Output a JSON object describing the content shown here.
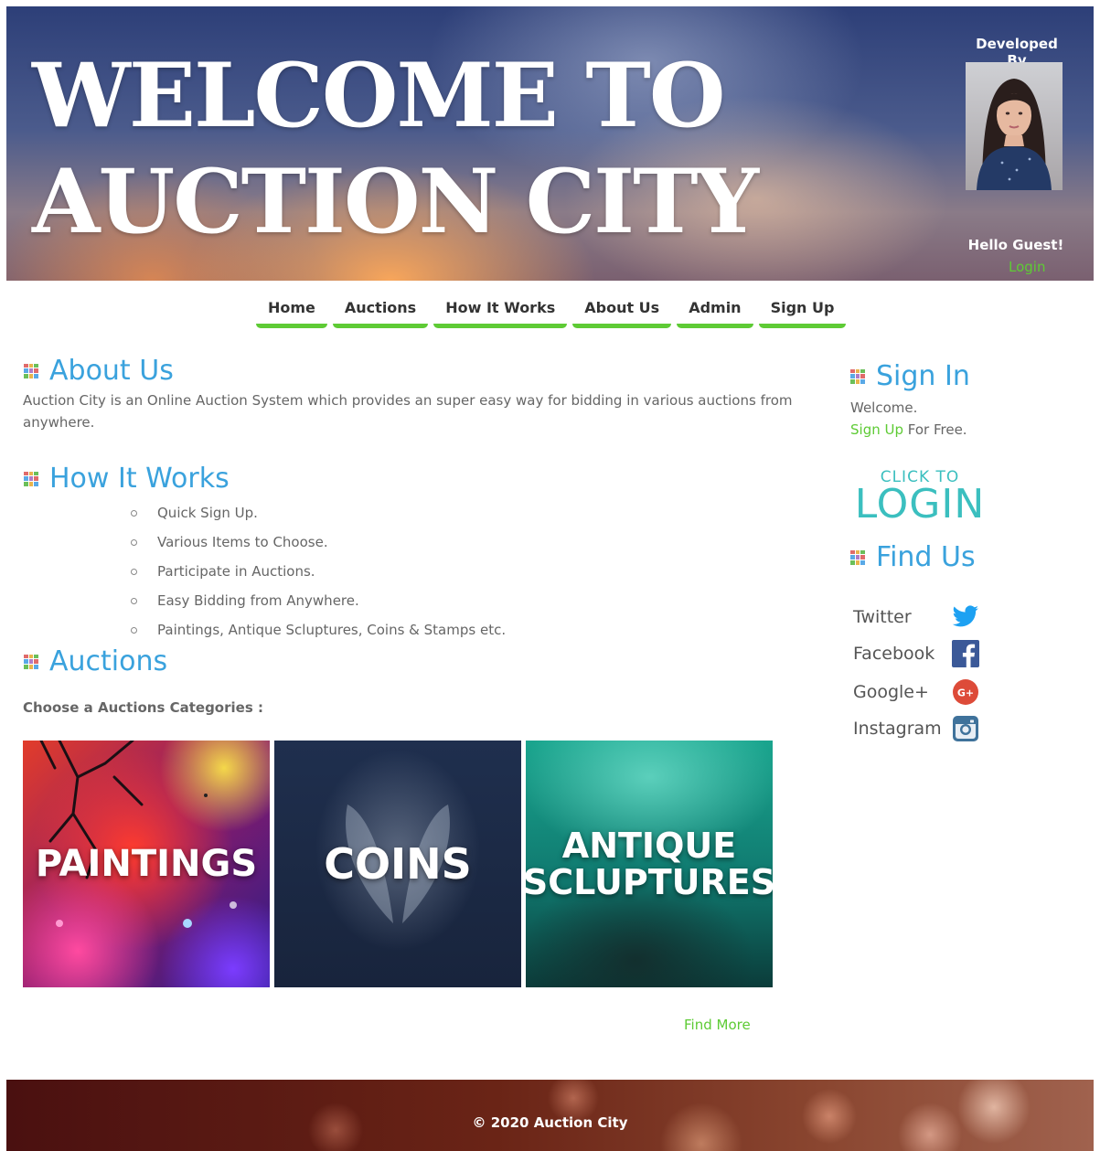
{
  "header": {
    "title_line1": "WELCOME TO",
    "title_line2": "AUCTION CITY",
    "developed_by": "Developed By",
    "greeting": "Hello Guest!",
    "login_link": "Login"
  },
  "nav": {
    "items": [
      {
        "label": "Home"
      },
      {
        "label": "Auctions"
      },
      {
        "label": "How It Works"
      },
      {
        "label": "About Us"
      },
      {
        "label": "Admin"
      },
      {
        "label": "Sign Up"
      }
    ]
  },
  "about": {
    "heading": "About Us",
    "text": "Auction City is an Online Auction System which provides an super easy way for bidding in various auctions from anywhere."
  },
  "how_it_works": {
    "heading": "How It Works",
    "items": [
      "Quick Sign Up.",
      "Various Items to Choose.",
      "Participate in Auctions.",
      "Easy Bidding from Anywhere.",
      "Paintings, Antique Scluptures, Coins & Stamps etc."
    ]
  },
  "auctions": {
    "heading": "Auctions",
    "subtitle": "Choose a Auctions Categories :",
    "categories": [
      {
        "label": "PAINTINGS"
      },
      {
        "label": "COINS"
      },
      {
        "label_line1": "ANTIQUE",
        "label_line2": "SCLUPTURES"
      }
    ],
    "find_more": "Find More"
  },
  "sidebar": {
    "signin_heading": "Sign In",
    "welcome": "Welcome.",
    "signup_link": "Sign Up",
    "signup_suffix": " For Free.",
    "login_graphic_small": "CLICK TO",
    "login_graphic_big": "LOGIN",
    "findus_heading": "Find Us",
    "social": [
      {
        "label": "Twitter",
        "icon": "twitter-icon",
        "color": "#1da1f2"
      },
      {
        "label": "Facebook",
        "icon": "facebook-icon",
        "color": "#3b5998"
      },
      {
        "label": "Google+",
        "icon": "google-plus-icon",
        "color": "#dd4b39"
      },
      {
        "label": "Instagram",
        "icon": "instagram-icon",
        "color": "#3f729b"
      }
    ]
  },
  "footer": {
    "copyright": "© 2020 Auction City"
  },
  "colors": {
    "accent_green": "#5ecb35",
    "heading_blue": "#3aa2dd"
  }
}
